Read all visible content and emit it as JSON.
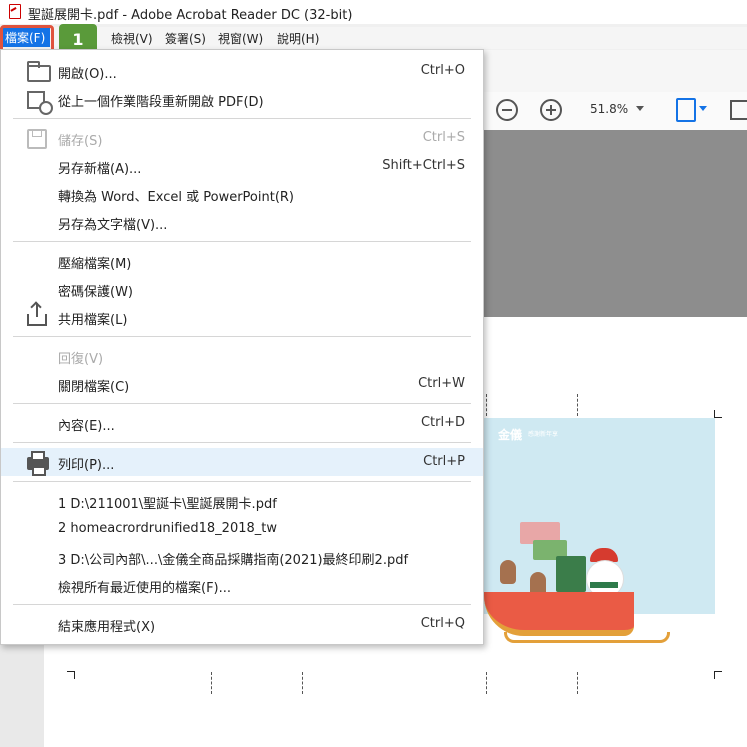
{
  "window": {
    "title": "聖誕展開卡.pdf - Adobe Acrobat Reader DC (32-bit)",
    "app_icon": "pdf-file-icon"
  },
  "menubar": {
    "items": [
      {
        "label": "檔案(F)",
        "active": true
      },
      {
        "label": "檢視(V)"
      },
      {
        "label": "簽署(S)"
      },
      {
        "label": "視窗(W)"
      },
      {
        "label": "說明(H)"
      }
    ],
    "step_badge": "1"
  },
  "toolbar": {
    "zoom_value": "51.8%",
    "icons": [
      "zoom-out-icon",
      "zoom-in-icon",
      "fit-page-icon",
      "more-tools-icon"
    ]
  },
  "file_menu": {
    "items": [
      {
        "label": "開啟(O)...",
        "shortcut": "Ctrl+O",
        "icon": "folder-open-icon",
        "enabled": true
      },
      {
        "label": "從上一個作業階段重新開啟 PDF(D)",
        "shortcut": "",
        "icon": "reopen-session-icon",
        "enabled": true
      },
      {
        "label": "儲存(S)",
        "shortcut": "Ctrl+S",
        "icon": "save-icon",
        "enabled": false
      },
      {
        "label": "另存新檔(A)...",
        "shortcut": "Shift+Ctrl+S",
        "enabled": true
      },
      {
        "label": "轉換為 Word、Excel 或 PowerPoint(R)",
        "shortcut": "",
        "enabled": true
      },
      {
        "label": "另存為文字檔(V)...",
        "shortcut": "",
        "enabled": true
      },
      {
        "label": "壓縮檔案(M)",
        "shortcut": "",
        "enabled": true
      },
      {
        "label": "密碼保護(W)",
        "shortcut": "",
        "enabled": true
      },
      {
        "label": "共用檔案(L)",
        "shortcut": "",
        "icon": "share-icon",
        "enabled": true
      },
      {
        "label": "回復(V)",
        "shortcut": "",
        "enabled": false
      },
      {
        "label": "關閉檔案(C)",
        "shortcut": "Ctrl+W",
        "enabled": true
      },
      {
        "label": "內容(E)...",
        "shortcut": "Ctrl+D",
        "enabled": true
      },
      {
        "label": "列印(P)...",
        "shortcut": "Ctrl+P",
        "icon": "printer-icon",
        "enabled": true,
        "highlighted": true
      },
      {
        "label": "1 D:\\211001\\聖誕卡\\聖誕展開卡.pdf",
        "shortcut": "",
        "enabled": true
      },
      {
        "label": "2 homeacrordrunified18_2018_tw",
        "shortcut": "",
        "enabled": true
      },
      {
        "label": "3 D:\\公司內部\\...\\金儀全商品採購指南(2021)最終印刷2.pdf",
        "shortcut": "",
        "enabled": true
      },
      {
        "label": "檢視所有最近使用的檔案(F)...",
        "shortcut": "",
        "enabled": true
      },
      {
        "label": "結束應用程式(X)",
        "shortcut": "Ctrl+Q",
        "enabled": true
      }
    ]
  },
  "document": {
    "card_brand": "金儀",
    "card_tagline": "感謝新年享"
  },
  "colors": {
    "menu_active": "#1473e6",
    "highlight_row": "#e5f1fb",
    "annotation_outline": "#e0533d",
    "step_badge": "#5a9a3a"
  }
}
